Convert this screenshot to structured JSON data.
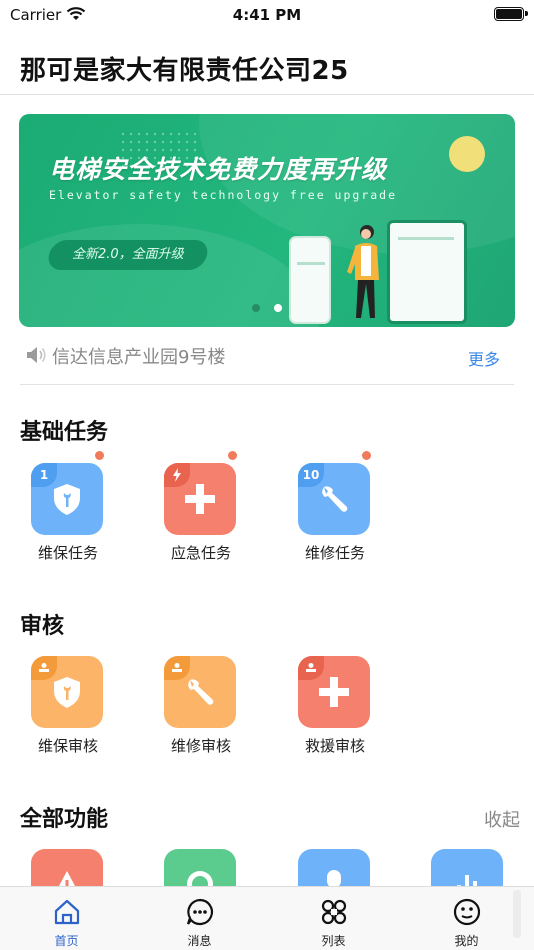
{
  "status_bar": {
    "carrier": "Carrier",
    "time": "4:41 PM"
  },
  "header": {
    "title": "那可是家大有限责任公司25"
  },
  "banner": {
    "title": "电梯安全技术免费力度再升级",
    "subtitle": "Elevator safety technology free upgrade",
    "pill": "全新2.0，全面升级",
    "page_count": 2,
    "active_page": 2
  },
  "notice": {
    "text": "信达信息产业园9号楼",
    "more": "更多"
  },
  "sections": {
    "basic_tasks": {
      "title": "基础任务",
      "items": [
        {
          "label": "维保任务",
          "badge": "1",
          "icon": "shield-wrench-icon",
          "color": "#6eb3fa"
        },
        {
          "label": "应急任务",
          "badge": "",
          "icon": "plus-icon",
          "color": "#f4806d"
        },
        {
          "label": "维修任务",
          "badge": "10",
          "icon": "wrench-icon",
          "color": "#6eb3fa"
        }
      ]
    },
    "review": {
      "title": "审核",
      "items": [
        {
          "label": "维保审核",
          "icon": "shield-wrench-icon",
          "color": "#fbb468"
        },
        {
          "label": "维修审核",
          "icon": "wrench-icon",
          "color": "#fbb468"
        },
        {
          "label": "救援审核",
          "icon": "plus-icon",
          "color": "#f4806d"
        }
      ]
    },
    "all_functions": {
      "title": "全部功能",
      "collapse": "收起",
      "items": [
        {
          "icon": "warning-icon",
          "color": "#f4806d"
        },
        {
          "icon": "chat-icon",
          "color": "#5ccb8e"
        },
        {
          "icon": "person-icon",
          "color": "#6eb3fa"
        },
        {
          "icon": "chart-icon",
          "color": "#6eb3fa"
        }
      ]
    }
  },
  "tabbar": {
    "items": [
      {
        "label": "首页",
        "icon": "home-icon",
        "active": true
      },
      {
        "label": "消息",
        "icon": "message-icon",
        "active": false
      },
      {
        "label": "列表",
        "icon": "grid-command-icon",
        "active": false
      },
      {
        "label": "我的",
        "icon": "smiley-icon",
        "active": false
      }
    ]
  },
  "colors": {
    "accent": "#2d63c8",
    "link": "#3a88e6",
    "badge_dot": "#f07a5a",
    "banner_green": "#22b77d"
  }
}
